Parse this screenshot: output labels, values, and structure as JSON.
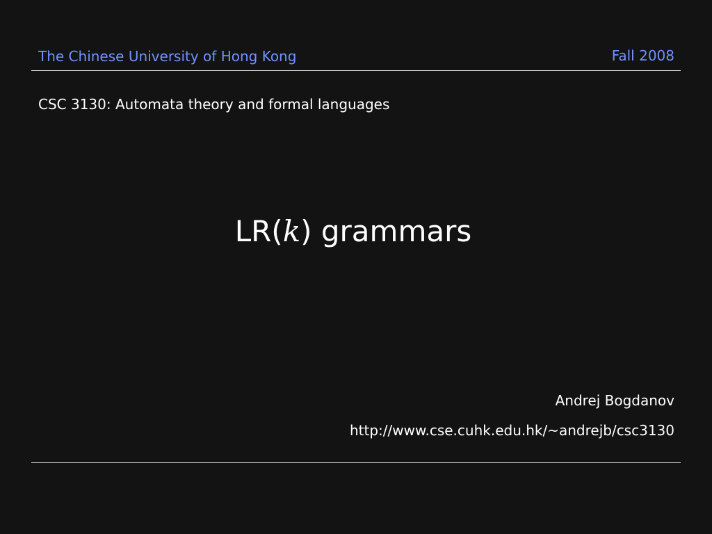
{
  "header": {
    "institution": "The Chinese University of Hong Kong",
    "term": "Fall 2008"
  },
  "course": "CSC 3130: Automata theory and formal languages",
  "title": {
    "prefix": "LR(",
    "variable": "k",
    "suffix": ") grammars"
  },
  "author": "Andrej Bogdanov",
  "url": "http://www.cse.cuhk.edu.hk/~andrejb/csc3130",
  "colors": {
    "background": "#131313",
    "accent": "#6f93ff",
    "text": "#ffffff",
    "rule": "#d6d6d6"
  }
}
